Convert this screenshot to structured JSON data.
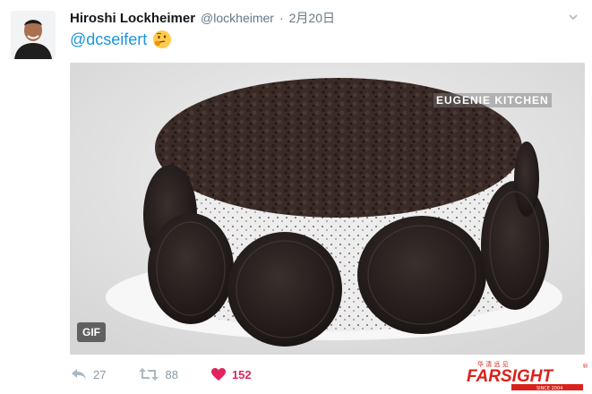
{
  "tweet": {
    "display_name": "Hiroshi Lockheimer",
    "handle": "@lockheimer",
    "separator": "·",
    "timestamp": "2月20日",
    "text": "@dcseifert"
  },
  "media": {
    "watermark": "EUGENIE KITCHEN",
    "badge": "GIF"
  },
  "actions": {
    "reply_count": "27",
    "retweet_count": "88",
    "like_count": "152"
  },
  "brand": {
    "top_text": "华 清 远 见",
    "logo_text": "FARSIGHT",
    "sub_text": "SINCE 2004",
    "registered": "®"
  },
  "colors": {
    "link": "#1b95e0",
    "muted": "#8899a6",
    "like": "#e0245e",
    "brand_red": "#d9221b"
  },
  "icons": {
    "emoji": "thinking-face",
    "reply": "reply-arrow",
    "retweet": "retweet-arrows",
    "like": "heart",
    "menu": "chevron-down"
  }
}
